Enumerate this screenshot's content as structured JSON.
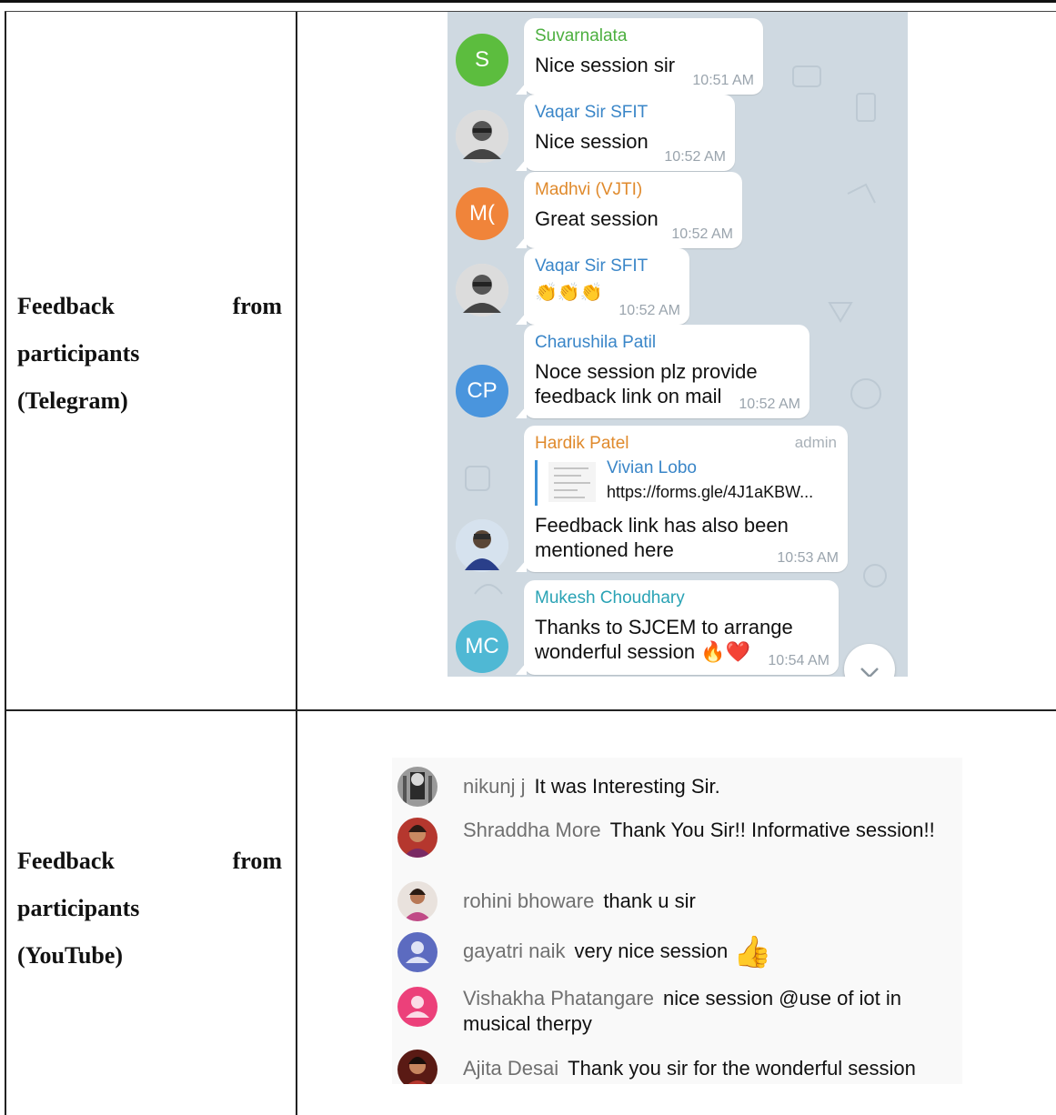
{
  "table": {
    "rows": [
      {
        "label_line1_left": "Feedback",
        "label_line1_right": "from",
        "label_line2": "participants",
        "label_line3": "(Telegram)"
      },
      {
        "label_line1_left": "Feedback",
        "label_line1_right": "from",
        "label_line2": "participants",
        "label_line3": "(YouTube)"
      }
    ]
  },
  "telegram": {
    "messages": [
      {
        "sender": "Suvarnalata",
        "sender_color": "#4caf3f",
        "text": "Nice session sir",
        "time": "10:51 AM",
        "avatar_initials": "S",
        "avatar_color": "#5cbd3e"
      },
      {
        "sender": "Vaqar Sir SFIT",
        "sender_color": "#3a86c8",
        "text": "Nice session",
        "time": "10:52 AM",
        "avatar_icon": "person-photo-icon"
      },
      {
        "sender": "Madhvi (VJTI)",
        "sender_color": "#e08a2c",
        "text": "Great session",
        "time": "10:52 AM",
        "avatar_initials": "M(",
        "avatar_color": "#f0843a"
      },
      {
        "sender": "Vaqar Sir SFIT",
        "sender_color": "#3a86c8",
        "text": "👏👏👏",
        "time": "10:52 AM",
        "avatar_icon": "person-photo-icon"
      },
      {
        "sender": "Charushila Patil",
        "sender_color": "#3a86c8",
        "text_line1": "Noce session plz provide",
        "text_line2": "feedback link on mail",
        "time": "10:52 AM",
        "avatar_initials": "CP",
        "avatar_color": "#4a95dd"
      },
      {
        "sender": "Hardik Patel",
        "sender_color": "#e08a2c",
        "badge": "admin",
        "quote_name": "Vivian Lobo",
        "quote_url": "https://forms.gle/4J1aKBW...",
        "text_line1": "Feedback link has also been",
        "text_line2": "mentioned here",
        "time": "10:53 AM",
        "avatar_icon": "person-photo-icon"
      },
      {
        "sender": "Mukesh Choudhary",
        "sender_color": "#2aa3b5",
        "text_line1": "Thanks to SJCEM to arrange",
        "text_line2": "wonderful session 🔥❤️",
        "time": "10:54 AM",
        "avatar_initials": "MC",
        "avatar_color": "#4fb8d4"
      }
    ]
  },
  "youtube": {
    "comments": [
      {
        "author": "nikunj j",
        "text": "It was Interesting Sir.",
        "avatar_icon": "person-photo-icon"
      },
      {
        "author": "Shraddha More",
        "text": "Thank You Sir!! Informative session!!",
        "avatar_icon": "person-photo-icon"
      },
      {
        "author": "rohini bhoware",
        "text": "thank u sir",
        "avatar_icon": "person-photo-icon"
      },
      {
        "author": "gayatri naik",
        "text": "very nice session",
        "emoji": "👍",
        "avatar_icon": "default-avatar-icon",
        "avatar_color": "#5c6bc0"
      },
      {
        "author": "Vishakha Phatangare",
        "text": "nice session @use of iot in musical therpy",
        "avatar_icon": "default-avatar-icon",
        "avatar_color": "#ec407a"
      },
      {
        "author": "Ajita Desai",
        "text": "Thank you sir for the wonderful session",
        "avatar_icon": "person-photo-icon"
      }
    ]
  }
}
